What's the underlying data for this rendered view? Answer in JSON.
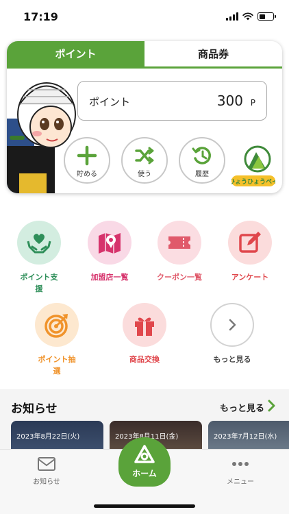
{
  "status": {
    "time": "17:19"
  },
  "card": {
    "tabs": [
      {
        "label": "ポイント",
        "active": true
      },
      {
        "label": "商品券",
        "active": false
      }
    ],
    "point_label": "ポイント",
    "point_value": "300",
    "point_unit": "P",
    "actions": [
      {
        "label": "貯める",
        "icon": "plus-icon"
      },
      {
        "label": "使う",
        "icon": "shuffle-icon"
      },
      {
        "label": "履歴",
        "icon": "history-icon"
      }
    ],
    "brand_text": "ひょうひょうペイ"
  },
  "menu": [
    {
      "label": "ポイント支援",
      "icon": "heart-hands-icon",
      "bg": "#d3ede0",
      "color": "#2f8f5a"
    },
    {
      "label": "加盟店一覧",
      "icon": "map-icon",
      "bg": "#f9d9e6",
      "color": "#d6336c"
    },
    {
      "label": "クーポン一覧",
      "icon": "ticket-icon",
      "bg": "#fbdde2",
      "color": "#e05a6b"
    },
    {
      "label": "アンケート",
      "icon": "edit-icon",
      "bg": "#fbdcdc",
      "color": "#e0474c"
    },
    {
      "label": "ポイント抽選",
      "icon": "target-icon",
      "bg": "#fde8cf",
      "color": "#f0932b"
    },
    {
      "label": "商品交換",
      "icon": "gift-icon",
      "bg": "#fbdcdc",
      "color": "#e0474c"
    },
    {
      "label": "もっと見る",
      "icon": "chevron-right-icon",
      "bg": "#ffffff",
      "color": "#444444"
    }
  ],
  "news": {
    "title": "お知らせ",
    "more": "もっと見る",
    "cards": [
      {
        "date": "2023年8月22日(火)"
      },
      {
        "date": "2023年8月11日(金)"
      },
      {
        "date": "2023年7月12日(水)"
      }
    ]
  },
  "bottom_nav": {
    "left": "お知らせ",
    "center": "ホーム",
    "right": "メニュー"
  },
  "colors": {
    "brand_green": "#5aa33a"
  }
}
